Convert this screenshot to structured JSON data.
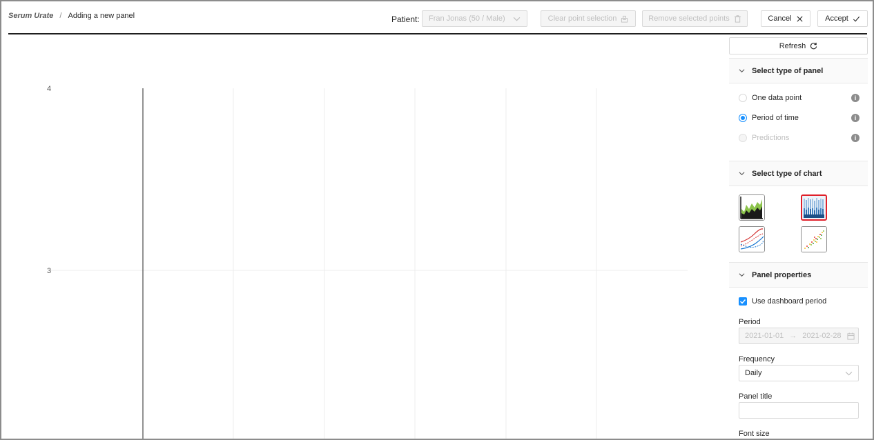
{
  "header": {
    "breadcrumb_title": "Serum Urate",
    "breadcrumb_separator": "/",
    "breadcrumb_current": "Adding a new panel",
    "patient_label": "Patient:",
    "patient_value": "Fran Jonas (50 / Male)",
    "clear_label": "Clear point selection",
    "remove_label": "Remove selected points",
    "cancel_label": "Cancel",
    "accept_label": "Accept"
  },
  "chart": {
    "y_ticks": [
      "4",
      "3"
    ]
  },
  "sidebar": {
    "refresh_label": "Refresh",
    "panel_type": {
      "heading": "Select type of panel",
      "options": [
        {
          "label": "One data point",
          "state": "unchecked"
        },
        {
          "label": "Period of time",
          "state": "checked"
        },
        {
          "label": "Predictions",
          "state": "disabled"
        }
      ]
    },
    "chart_type": {
      "heading": "Select type of chart",
      "options": [
        {
          "name": "area-chart",
          "selected": false
        },
        {
          "name": "stacked-bar-chart",
          "selected": true
        },
        {
          "name": "line-chart",
          "selected": false
        },
        {
          "name": "scatter-chart",
          "selected": false
        }
      ]
    },
    "properties": {
      "heading": "Panel properties",
      "use_dashboard_period_label": "Use dashboard period",
      "use_dashboard_period_checked": true,
      "period_label": "Period",
      "period_start": "2021-01-01",
      "period_arrow": "→",
      "period_end": "2021-02-28",
      "frequency_label": "Frequency",
      "frequency_value": "Daily",
      "panel_title_label": "Panel title",
      "panel_title_value": "",
      "font_size_label": "Font size"
    }
  },
  "colors": {
    "accent": "#1890ff",
    "selected_border": "#e0202a",
    "area_green": "#7cb342"
  }
}
